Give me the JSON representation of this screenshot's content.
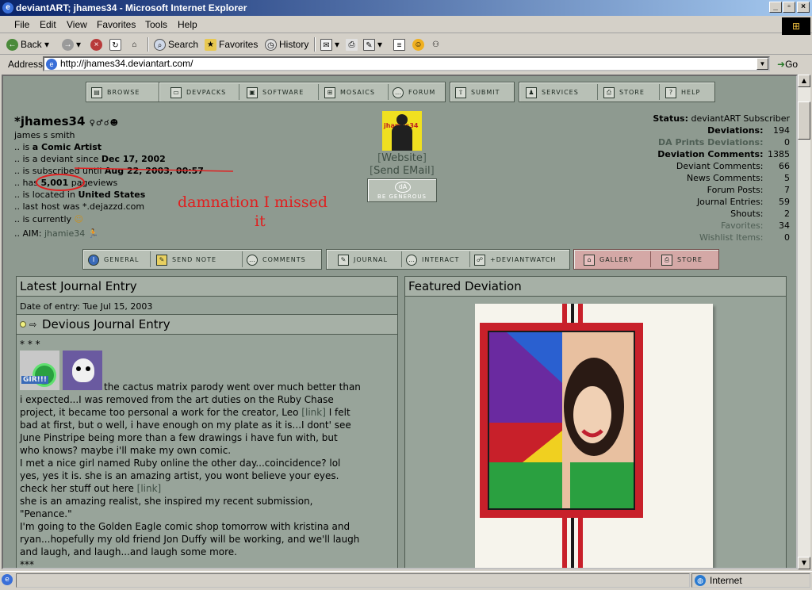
{
  "window": {
    "title": "deviantART; jhames34 - Microsoft Internet Explorer",
    "minimize": "_",
    "maximize": "▫",
    "close": "×"
  },
  "menu": [
    "File",
    "Edit",
    "View",
    "Favorites",
    "Tools",
    "Help"
  ],
  "toolbar": {
    "back": "Back",
    "search": "Search",
    "favorites": "Favorites",
    "history": "History"
  },
  "address": {
    "label": "Address",
    "url": "http://jhames34.deviantart.com/",
    "go": "Go"
  },
  "topnav": [
    "browse",
    "devpacks",
    "software",
    "mosaics",
    "forum",
    "submit",
    "services",
    "store",
    "help"
  ],
  "profile": {
    "username": "*jhames34",
    "realname": "james s smith",
    "line1_pre": ".. is ",
    "line1_val": "a Comic Artist",
    "line2_pre": ".. is a deviant since ",
    "line2_val": "Dec 17, 2002",
    "line3_pre": ".. is subscribed until ",
    "line3_val": "Aug 22, 2003, 00:57",
    "line4_pre": ".. has ",
    "line4_val": "5,001",
    "line4_post": " pageviews",
    "line5_pre": ".. is located in ",
    "line5_val": "United States",
    "line6": ".. last host was *.dejazzd.com",
    "line7": ".. is currently",
    "line8_pre": ".. AIM: ",
    "line8_val": "jhamie34",
    "annotation1": "damnation I missed",
    "annotation2": "it",
    "website": "Website",
    "send_email": "Send EMail",
    "generous": "BE GENEROUS",
    "avatar_caption": "jhames34"
  },
  "stats": [
    {
      "label": "Status:",
      "value": "deviantART Subscriber"
    },
    {
      "label": "Deviations:",
      "value": "194"
    },
    {
      "label": "DA Prints Deviations:",
      "value": "0"
    },
    {
      "label": "Deviation Comments:",
      "value": "1385"
    },
    {
      "label": "Deviant Comments:",
      "value": "66"
    },
    {
      "label": "News Comments:",
      "value": "5"
    },
    {
      "label": "Forum Posts:",
      "value": "7"
    },
    {
      "label": "Journal Entries:",
      "value": "59"
    },
    {
      "label": "Shouts:",
      "value": "2"
    },
    {
      "label": "Favorites:",
      "value": "34"
    },
    {
      "label": "Wishlist Items:",
      "value": "0"
    }
  ],
  "subnav": [
    "general",
    "send note",
    "comments",
    "journal",
    "interact",
    "+deviantwatch",
    "gallery",
    "store"
  ],
  "journal": {
    "header": "Latest Journal Entry",
    "date": "Date of entry: Tue Jul 15, 2003",
    "title": "Devious Journal Entry",
    "stars": "* * *",
    "gir": "GIR!!!",
    "l1": "the cactus matrix parody went over much better than",
    "l2": "i expected...I was removed from the art duties on the Ruby Chase",
    "l3": "project, it became too personal a work for the creator, Leo",
    "link": "[link]",
    "l3b": " I felt",
    "l4": "bad at first, but o well, i have enough on my plate as it is...I dont' see",
    "l5": "June Pinstripe being more than a few drawings i have fun with, but",
    "l6": "who knows? maybe i'll make my own comic.",
    "l7": "I met a nice girl named Ruby online the other day...coincidence? lol",
    "l8": "yes, yes it is. she is an amazing artist, you wont believe your eyes.",
    "l9": "check her stuff out here ",
    "l10": "she is an amazing realist, she inspired my recent submission,",
    "l11": "\"Penance.\"",
    "l12": "I'm going to the Golden Eagle comic shop tomorrow with kristina and",
    "l13": "ryan...hopefully my old friend Jon Duffy will be working, and we'll laugh",
    "l14": "and laugh, and laugh...and laugh some more.",
    "l15": "***"
  },
  "featured": {
    "header": "Featured Deviation"
  },
  "status": {
    "zone": "Internet"
  }
}
